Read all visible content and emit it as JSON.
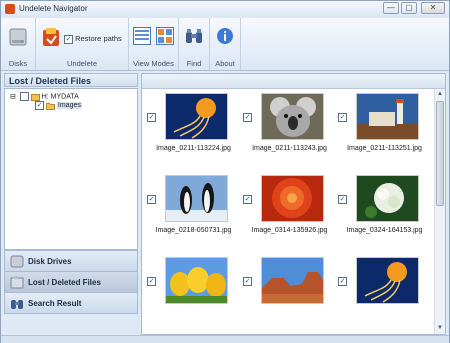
{
  "window": {
    "title": "Undelete Navigator",
    "min_glyph": "—",
    "max_glyph": "▢",
    "close_glyph": "✕"
  },
  "ribbon": {
    "groups": {
      "disks": "Disks",
      "undelete": "Undelete",
      "view_modes": "View Modes",
      "find": "Find",
      "about": "About"
    },
    "restore_paths": {
      "label": "Restore paths",
      "checked": true
    }
  },
  "left_panel": {
    "header": "Lost / Deleted Files",
    "tree": [
      {
        "expander": "⊟",
        "label": "H: MYDATA",
        "checked": false
      },
      {
        "label": "Images",
        "checked": true
      }
    ],
    "nav": [
      {
        "label": "Disk Drives"
      },
      {
        "label": "Lost / Deleted Files"
      },
      {
        "label": "Search Result"
      }
    ]
  },
  "files": [
    {
      "name": "Image_0211-113224.jpg",
      "checked": true,
      "icon": "jellyfish-photo"
    },
    {
      "name": "Image_0211-113243.jpg",
      "checked": true,
      "icon": "koala-photo"
    },
    {
      "name": "Image_0211-113251.jpg",
      "checked": true,
      "icon": "lighthouse-photo"
    },
    {
      "name": "Image_0218-050731.jpg",
      "checked": true,
      "icon": "penguins-photo"
    },
    {
      "name": "Image_0314-135926.jpg",
      "checked": true,
      "icon": "chrysanthemum-photo"
    },
    {
      "name": "Image_0324-164153.jpg",
      "checked": true,
      "icon": "hydrangeas-photo"
    },
    {
      "name": "",
      "checked": true,
      "icon": "tulips-photo"
    },
    {
      "name": "",
      "checked": true,
      "icon": "desert-photo"
    },
    {
      "name": "",
      "checked": true,
      "icon": "jellyfish-photo"
    }
  ],
  "check_glyph": "✓",
  "scroll": {
    "up": "▲",
    "down": "▼"
  },
  "colors": {
    "accent": "#1f4f9f",
    "frame": "#8ea3bd",
    "panel": "#dfe9f5"
  }
}
